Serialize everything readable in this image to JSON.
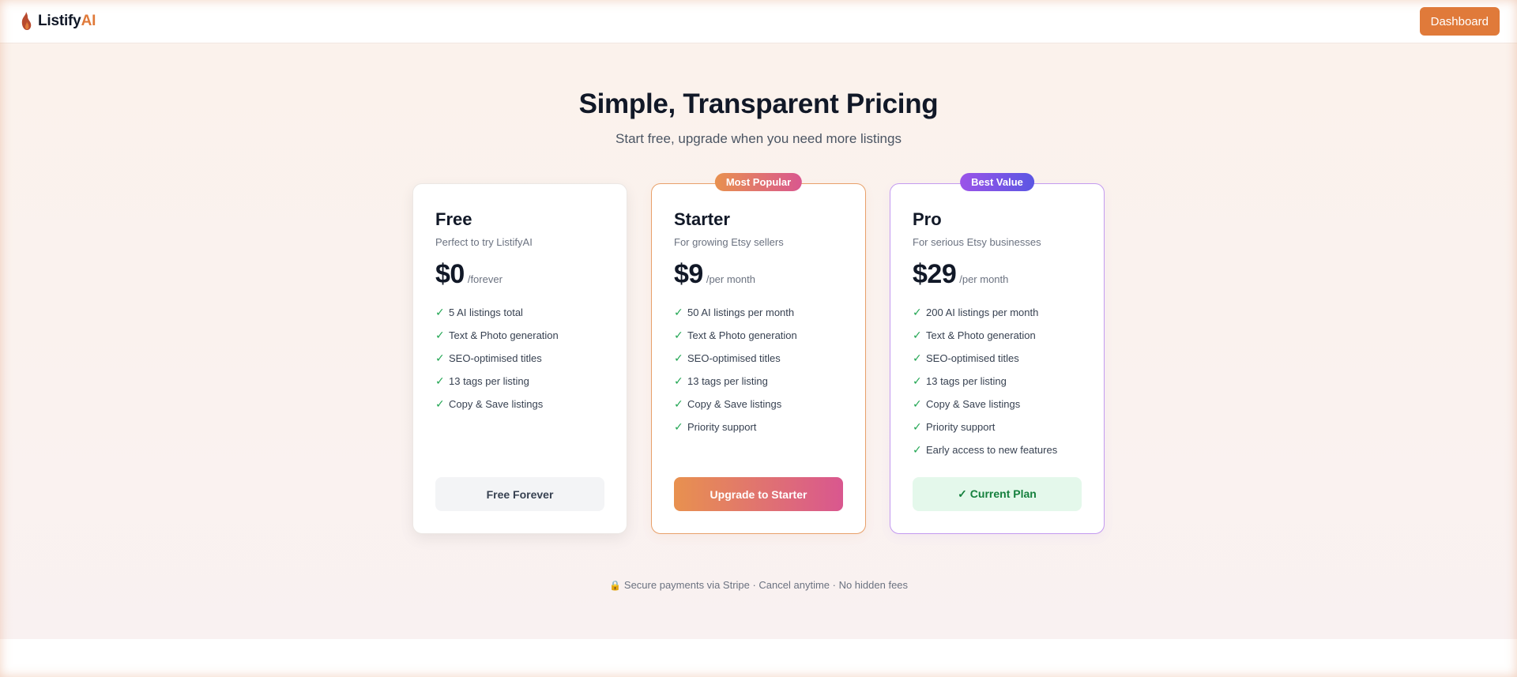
{
  "nav": {
    "brand_prefix": "Listify",
    "brand_suffix": "AI",
    "dashboard_label": "Dashboard"
  },
  "hero": {
    "title": "Simple, Transparent Pricing",
    "subtitle": "Start free, upgrade when you need more listings"
  },
  "plans": [
    {
      "name": "Free",
      "description": "Perfect to try ListifyAI",
      "price": "$0",
      "period": "/forever",
      "features": [
        "5 AI listings total",
        "Text & Photo generation",
        "SEO-optimised titles",
        "13 tags per listing",
        "Copy & Save listings"
      ],
      "button_label": "Free Forever"
    },
    {
      "name": "Starter",
      "badge": "Most Popular",
      "description": "For growing Etsy sellers",
      "price": "$9",
      "period": "/per month",
      "features": [
        "50 AI listings per month",
        "Text & Photo generation",
        "SEO-optimised titles",
        "13 tags per listing",
        "Copy & Save listings",
        "Priority support"
      ],
      "button_label": "Upgrade to Starter"
    },
    {
      "name": "Pro",
      "badge": "Best Value",
      "description": "For serious Etsy businesses",
      "price": "$29",
      "period": "/per month",
      "features": [
        "200 AI listings per month",
        "Text & Photo generation",
        "SEO-optimised titles",
        "13 tags per listing",
        "Copy & Save listings",
        "Priority support",
        "Early access to new features"
      ],
      "button_label": "✓ Current Plan"
    }
  ],
  "footnote": {
    "icon": "lock-icon",
    "text": "Secure payments via Stripe · Cancel anytime · No hidden fees"
  },
  "colors": {
    "accent": "#e07a3a",
    "pink": "#d9578f",
    "purple": "#9b54e8",
    "success": "#22a653"
  }
}
